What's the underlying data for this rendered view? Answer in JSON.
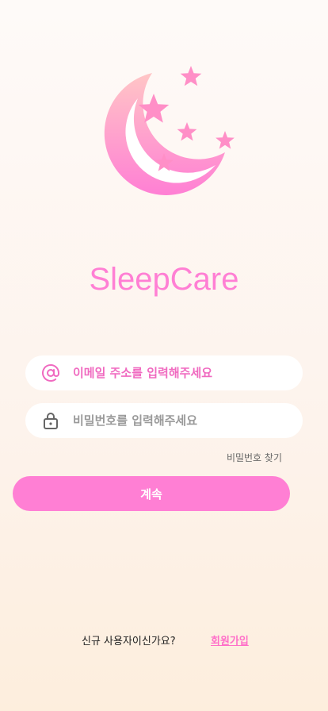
{
  "app": {
    "title": "SleepCare"
  },
  "colors": {
    "accent": "#ff7fd4",
    "logo_pink": "#ff8fc7"
  },
  "login_form": {
    "email": {
      "icon": "at-sign-icon",
      "value": "",
      "placeholder": "이메일 주소를 입력해주세요"
    },
    "password": {
      "icon": "lock-icon",
      "value": "",
      "placeholder": "비밀번호를 입력해주세요"
    },
    "forgot_password_label": "비밀번호 찾기",
    "continue_label": "계속"
  },
  "signup": {
    "prompt": "신규 사용자이신가요?",
    "link_label": "회원가입"
  }
}
